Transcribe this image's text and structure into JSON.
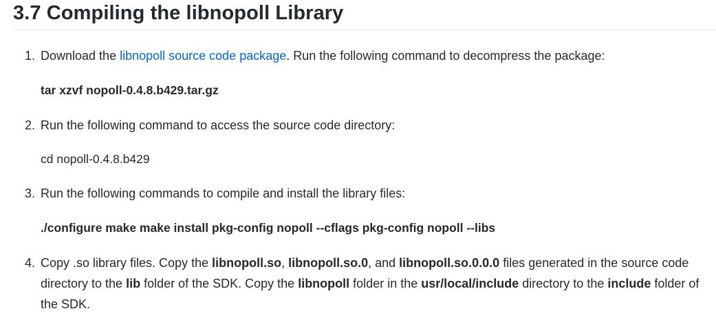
{
  "heading": "3.7 Compiling the libnopoll Library",
  "steps": [
    {
      "number": "1.",
      "pre": "Download the ",
      "link": "libnopoll source code package",
      "post": ". Run the following command to decompress the package:",
      "command": "tar xzvf nopoll-0.4.8.b429.tar.gz"
    },
    {
      "number": "2.",
      "text": "Run the following command to access the source code directory:",
      "command": "cd nopoll-0.4.8.b429"
    },
    {
      "number": "3.",
      "text": "Run the following commands to compile and install the library files:",
      "command": "./configure make make install pkg-config nopoll --cflags pkg-config nopoll --libs"
    },
    {
      "number": "4.",
      "parts": [
        "Copy .so library files. Copy the ",
        "libnopoll.so",
        ", ",
        "libnopoll.so.0",
        ", and ",
        "libnopoll.so.0.0.0",
        " files generated in the source code directory to the ",
        "lib",
        " folder of the SDK. Copy the ",
        "libnopoll",
        " folder in the ",
        "usr/local/include",
        " directory to the ",
        "include",
        " folder of the SDK."
      ]
    }
  ]
}
